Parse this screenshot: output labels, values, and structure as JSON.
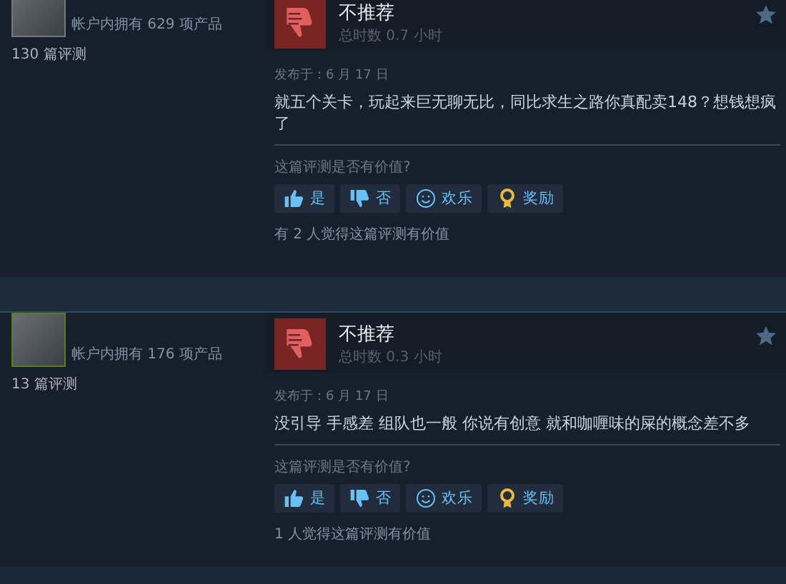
{
  "reviews": [
    {
      "author": {
        "products": "帐户内拥有 629 项产品",
        "review_count": "130 篇评测"
      },
      "recommended": false,
      "verdict": "不推荐",
      "hours": "总时数 0.7 小时",
      "posted": "发布于：6 月 17 日",
      "text": "就五个关卡，玩起来巨无聊无比，同比求生之路你真配卖148？想钱想疯了",
      "helpful_prompt": "这篇评测是否有价值?",
      "buttons": [
        {
          "kind": "yes",
          "label": "是"
        },
        {
          "kind": "no",
          "label": "否"
        },
        {
          "kind": "funny",
          "label": "欢乐"
        },
        {
          "kind": "award",
          "label": "奖励"
        }
      ],
      "helpful_count": "有 2 人觉得这篇评测有价值"
    },
    {
      "author": {
        "products": "帐户内拥有 176 项产品",
        "review_count": "13 篇评测"
      },
      "recommended": false,
      "verdict": "不推荐",
      "hours": "总时数 0.3 小时",
      "posted": "发布于：6 月 17 日",
      "text": "没引导 手感差 组队也一般 你说有创意 就和咖喱味的屎的概念差不多",
      "helpful_prompt": "这篇评测是否有价值?",
      "buttons": [
        {
          "kind": "yes",
          "label": "是"
        },
        {
          "kind": "no",
          "label": "否"
        },
        {
          "kind": "funny",
          "label": "欢乐"
        },
        {
          "kind": "award",
          "label": "奖励"
        }
      ],
      "helpful_count": "1 人觉得这篇评测有价值"
    }
  ]
}
